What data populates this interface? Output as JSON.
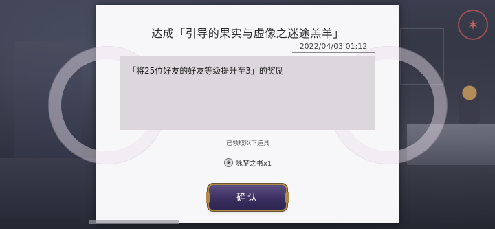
{
  "dialog": {
    "title": "达成「引导的果实与虚像之迷途羔羊」",
    "date": "2022/04/03 01:12",
    "message": "「将25位好友的好友等级提升至3」的奖励",
    "received_label": "已领取以下道具",
    "item": {
      "name": "咏梦之书x1",
      "icon": "book-coin-icon"
    },
    "confirm_label": "确认"
  },
  "colors": {
    "panel": "#f7f6f8",
    "message_box": "#dcd7dc",
    "button_purple": "#3b3060",
    "button_gold": "#b08a4a"
  }
}
